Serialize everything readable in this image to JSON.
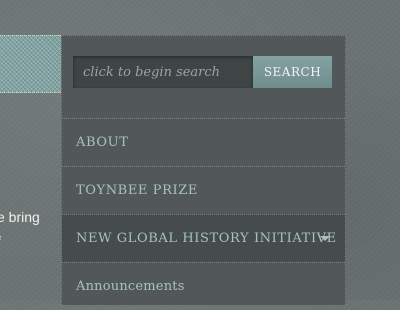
{
  "left_text": {
    "line1": "e bring",
    "line2": "f"
  },
  "search": {
    "placeholder": "click to begin search",
    "button_label": "SEARCH"
  },
  "nav": {
    "items": [
      {
        "label": "ABOUT"
      },
      {
        "label": "TOYNBEE PRIZE"
      },
      {
        "label": "NEW GLOBAL HISTORY INITIATIVE",
        "has_dropdown": true,
        "icon": "chevron-down-icon"
      },
      {
        "label": "Announcements"
      }
    ]
  },
  "colors": {
    "page_background": "#6b7373",
    "panel_background": "#525858",
    "accent_teal": "#7a9898",
    "link_text": "#a5c2c0"
  }
}
